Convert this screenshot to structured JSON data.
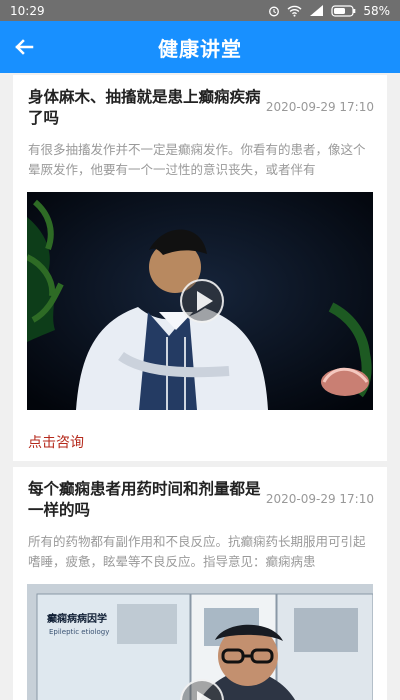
{
  "status": {
    "time": "10:29",
    "battery": "58%",
    "icons": [
      "alarm-icon",
      "wifi-icon",
      "signal-icon",
      "battery-icon"
    ]
  },
  "header": {
    "title": "健康讲堂",
    "back_icon": "arrow-left-icon",
    "background": "#1890ff"
  },
  "articles": [
    {
      "title": "身体麻木、抽搐就是患上癫痫疾病了吗",
      "date": "2020-09-29 17:10",
      "summary": "有很多抽搐发作并不一定是癫痫发作。你看有的患者，像这个晕厥发作，他要有一个一过性的意识丧失，或者伴有",
      "action": "点击咨询",
      "play_icon": "play-icon"
    },
    {
      "title": "每个癫痫患者用药时间和剂量都是一样的吗",
      "date": "2020-09-29 17:10",
      "summary": "所有的药物都有副作用和不良反应。抗癫痫药长期服用可引起嗜睡，疲惫，眩晕等不良反应。指导意见：癫痫病患",
      "video_sign_text": "癫痫病病因学",
      "video_sign_subtext": "Epileptic etiology",
      "play_icon": "play-icon"
    }
  ],
  "colors": {
    "action": "#b52a1c",
    "date": "#999999",
    "summary": "#9a9a9a"
  }
}
